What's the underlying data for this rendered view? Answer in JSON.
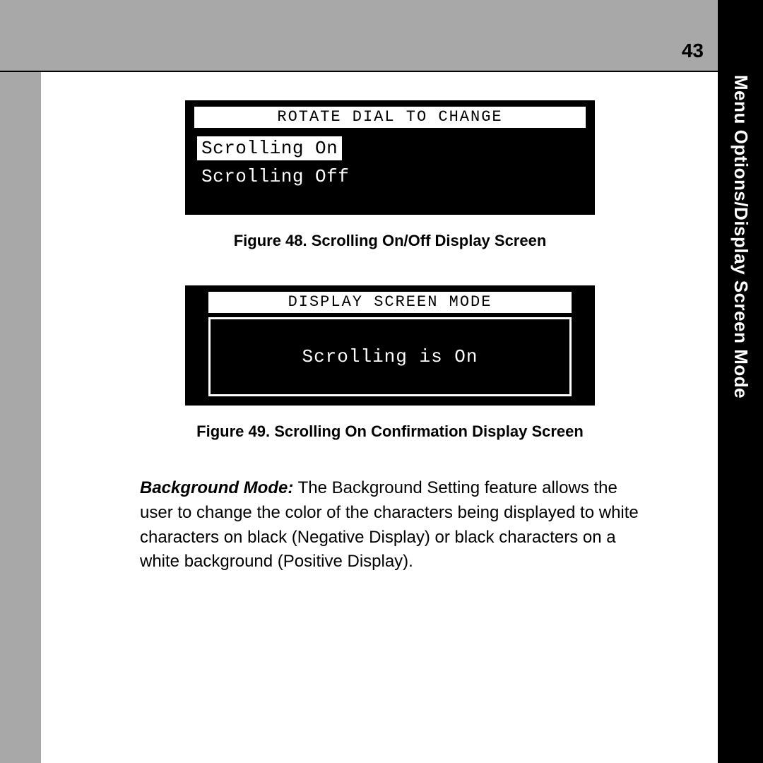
{
  "page_number": "43",
  "side_tab": "Menu Options/Display Screen Mode",
  "figure48": {
    "header": "ROTATE DIAL TO CHANGE",
    "option_selected": "Scrolling On",
    "option_unselected": "Scrolling Off",
    "caption": "Figure 48. Scrolling On/Off Display Screen"
  },
  "figure49": {
    "header": "DISPLAY SCREEN MODE",
    "message": "Scrolling is On",
    "caption": "Figure 49. Scrolling On Confirmation Display Screen"
  },
  "paragraph": {
    "lead": "Background Mode:",
    "body": " The Background Setting feature allows the user to change the color of the characters being displayed to white characters on black (Negative Display) or black characters on a white background (Positive Display)."
  }
}
